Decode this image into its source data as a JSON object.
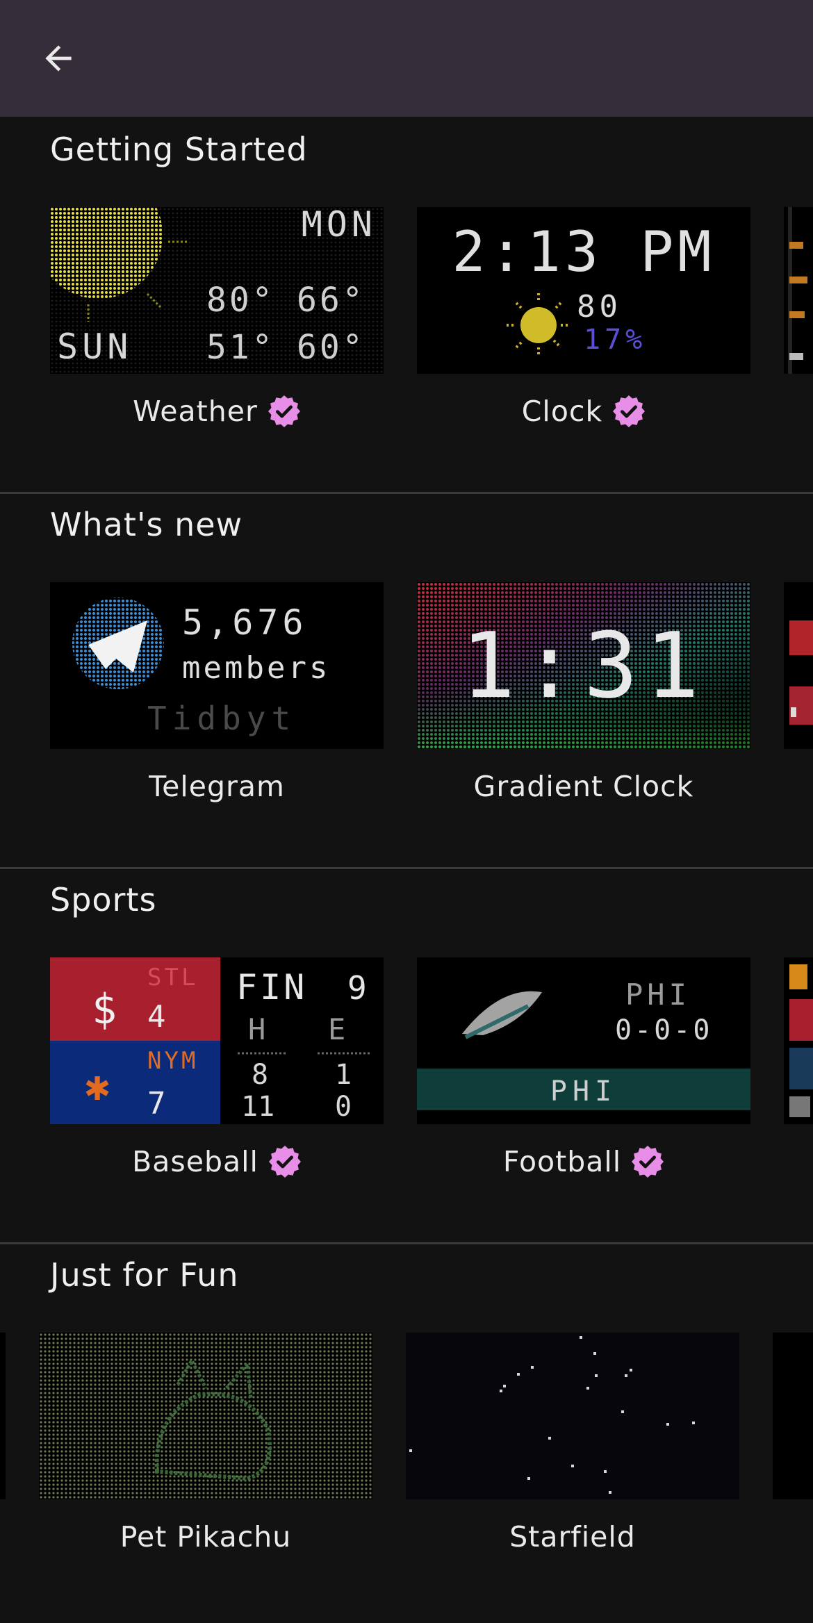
{
  "colors": {
    "topbar": "#352d3a",
    "background": "#121212",
    "badge": "#e98ee8",
    "divider": "#3a3a3a"
  },
  "header": {
    "back_icon": "arrow-left-icon"
  },
  "sections": [
    {
      "title": "Getting Started",
      "cards": [
        {
          "label": "Weather",
          "verified": true
        },
        {
          "label": "Clock",
          "verified": true
        }
      ]
    },
    {
      "title": "What's new",
      "cards": [
        {
          "label": "Telegram",
          "verified": false
        },
        {
          "label": "Gradient Clock",
          "verified": false
        }
      ]
    },
    {
      "title": "Sports",
      "cards": [
        {
          "label": "Baseball",
          "verified": true
        },
        {
          "label": "Football",
          "verified": true
        }
      ]
    },
    {
      "title": "Just for Fun",
      "cards": [
        {
          "label": "Pet Pikachu",
          "verified": false
        },
        {
          "label": "Starfield",
          "verified": false
        }
      ]
    }
  ],
  "thumbnails": {
    "weather": {
      "day1": "MON",
      "day1_high": "80°",
      "day1_low": "66°",
      "day2": "SUN",
      "day2_high": "51°",
      "day2_low": "60°"
    },
    "clock": {
      "time": "2:13 PM",
      "temp": "80",
      "humidity": "17%"
    },
    "telegram": {
      "count": "5,676",
      "unit": "members",
      "brand": "Tidbyt"
    },
    "gradient_clock": {
      "time": "1:31"
    },
    "baseball": {
      "team1": "STL",
      "score1": "4",
      "team2": "NYM",
      "score2": "7",
      "status": "FIN",
      "inning": "9",
      "h_label": "H",
      "e_label": "E",
      "h1": "8",
      "e1": "1",
      "h2": "11",
      "e2": "0"
    },
    "football": {
      "team": "PHI",
      "record": "0-0-0",
      "ticker": "PHI"
    }
  }
}
